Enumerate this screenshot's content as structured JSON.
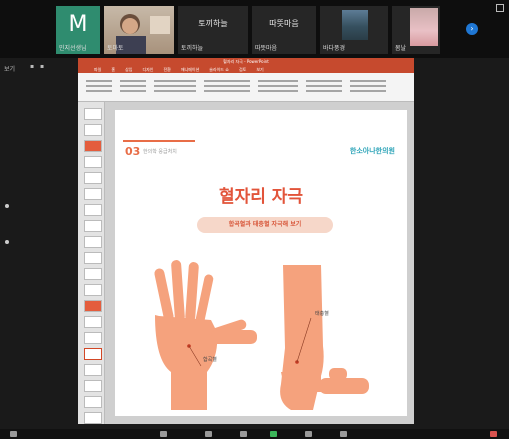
{
  "participants": [
    {
      "type": "avatar",
      "initial": "M",
      "name": "민지선생님"
    },
    {
      "type": "video",
      "name": "토마토"
    },
    {
      "type": "name",
      "display": "토끼하늘",
      "name": "토끼하늘"
    },
    {
      "type": "name",
      "display": "따뜻마음",
      "name": "따뜻마음"
    },
    {
      "type": "video",
      "name": "바다풍경"
    },
    {
      "type": "video",
      "name": "봄날"
    }
  ],
  "more_label": "›",
  "toolbar_left_label": "보기",
  "ppt": {
    "window_title": "혈자리 자극 - PowerPoint",
    "tabs": [
      "파일",
      "홈",
      "삽입",
      "디자인",
      "전환",
      "애니메이션",
      "슬라이드 쇼",
      "검토",
      "보기"
    ]
  },
  "slide": {
    "number": "03",
    "subtitle": "한의학 응급처치",
    "logo": "한소아나한의원",
    "title": "혈자리 자극",
    "pill": "합곡혈과 태충혈 자극해 보기",
    "label_hand": "합곡혈",
    "label_foot": "태충혈"
  },
  "colors": {
    "accent": "#e2543a",
    "skin": "#f5a27d",
    "logo": "#2da4b8"
  }
}
